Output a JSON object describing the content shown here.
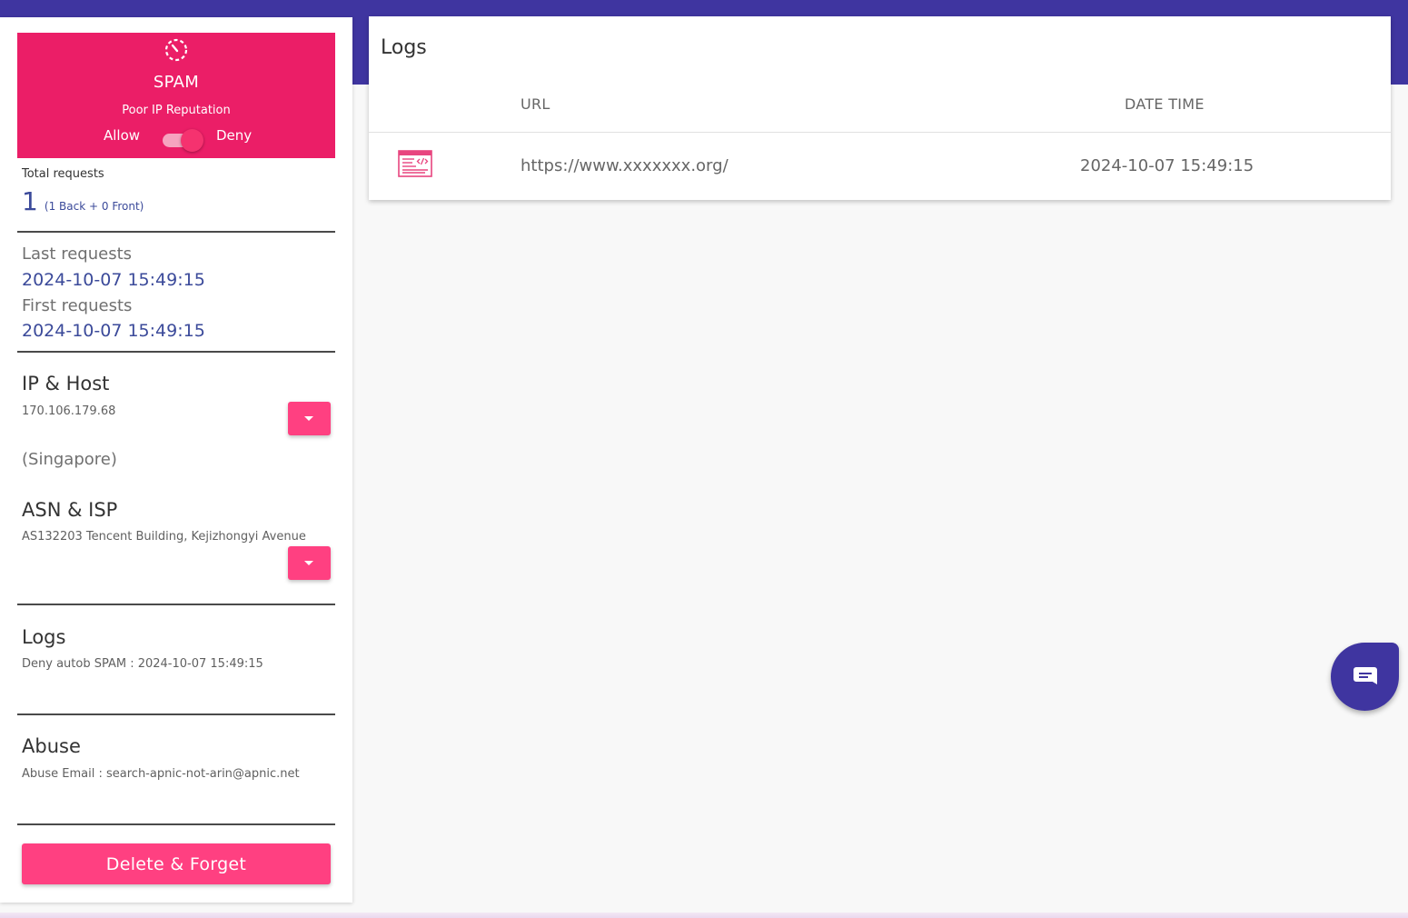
{
  "colors": {
    "primary": "#3f35a0",
    "accent": "#ff4081",
    "status_bg": "#eb1e67",
    "value_blue": "#3b4a9a"
  },
  "status": {
    "icon": "timer-icon",
    "title": "SPAM",
    "subtitle": "Poor IP Reputation",
    "allow_label": "Allow",
    "deny_label": "Deny",
    "toggle_state": "deny"
  },
  "totals": {
    "label": "Total requests",
    "count": "1",
    "detail": "(1 Back + 0 Front)"
  },
  "requests": {
    "last_label": "Last requests",
    "last_value": "2024-10-07 15:49:15",
    "first_label": "First requests",
    "first_value": "2024-10-07 15:49:15"
  },
  "ip_host": {
    "title": "IP & Host",
    "ip": "170.106.179.68",
    "country": "(Singapore)"
  },
  "asn": {
    "title": "ASN & ISP",
    "value": "AS132203 Tencent Building, Kejizhongyi Avenue"
  },
  "side_logs": {
    "title": "Logs",
    "entry": "Deny autob SPAM : 2024-10-07 15:49:15"
  },
  "abuse": {
    "title": "Abuse",
    "email_line": "Abuse Email : search-apnic-not-arin@apnic.net"
  },
  "delete_button": "Delete & Forget",
  "logs_table": {
    "title": "Logs",
    "columns": [
      "URL",
      "DATE TIME"
    ],
    "rows": [
      {
        "icon": "web-code-icon",
        "url": "https://www.xxxxxxx.org/",
        "datetime": "2024-10-07 15:49:15"
      }
    ]
  },
  "chat_icon": "chat-bubble-icon"
}
